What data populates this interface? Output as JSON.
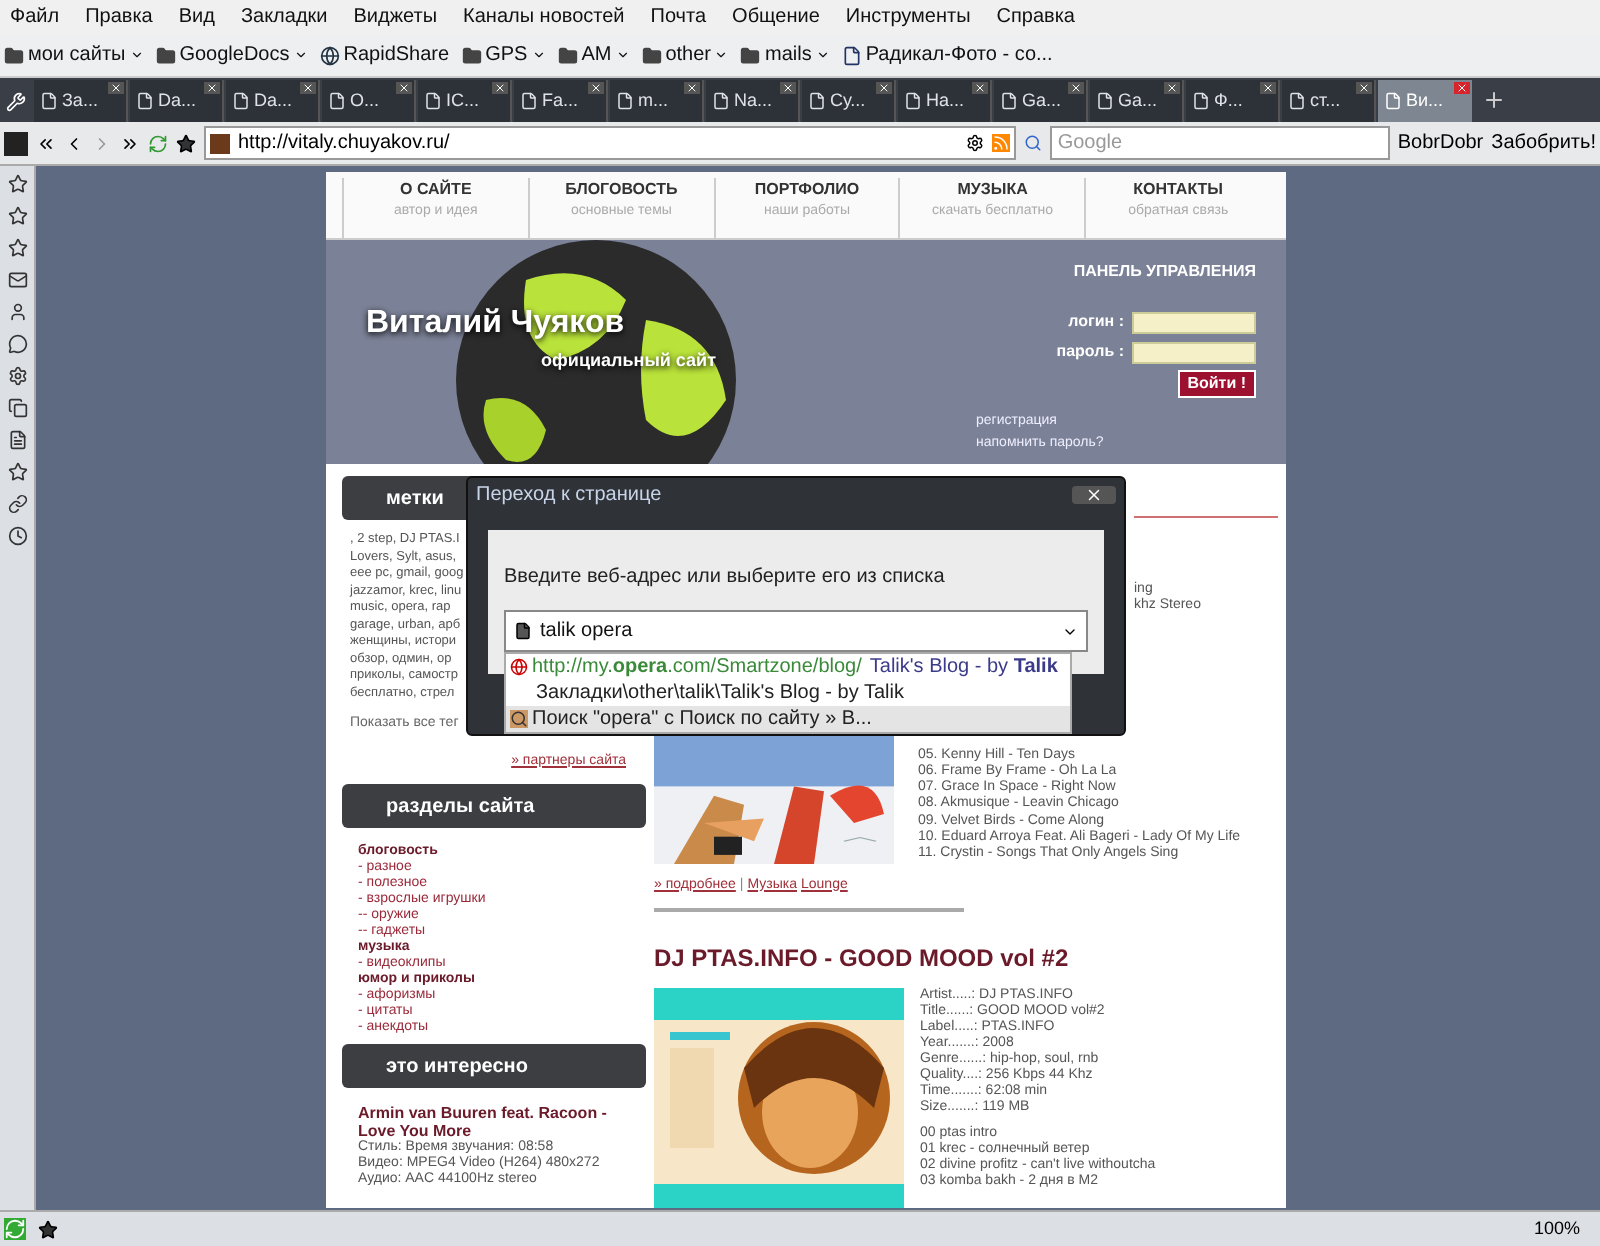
{
  "menu": [
    "Файл",
    "Правка",
    "Вид",
    "Закладки",
    "Виджеты",
    "Каналы новостей",
    "Почта",
    "Общение",
    "Инструменты",
    "Справка"
  ],
  "bookmarks": [
    {
      "label": "мои сайты",
      "kind": "folder",
      "has_menu": true
    },
    {
      "label": "GoogleDocs",
      "kind": "folder",
      "has_menu": true
    },
    {
      "label": "RapidShare",
      "kind": "site",
      "has_menu": false
    },
    {
      "label": "GPS",
      "kind": "folder",
      "has_menu": true
    },
    {
      "label": "AM",
      "kind": "folder",
      "has_menu": true
    },
    {
      "label": "other",
      "kind": "folder",
      "has_menu": true
    },
    {
      "label": "mails",
      "kind": "folder",
      "has_menu": true
    },
    {
      "label": "Радикал-Фото - со...",
      "has_menu": false
    }
  ],
  "tabs": [
    {
      "title": "За...",
      "selected": false
    },
    {
      "title": "Da...",
      "selected": false
    },
    {
      "title": "Da...",
      "selected": false
    },
    {
      "title": "O...",
      "selected": false
    },
    {
      "title": "IC...",
      "selected": false
    },
    {
      "title": "Fa...",
      "selected": false
    },
    {
      "title": "m...",
      "selected": false
    },
    {
      "title": "Na...",
      "selected": false
    },
    {
      "title": "Су...",
      "selected": false
    },
    {
      "title": "На...",
      "selected": false
    },
    {
      "title": "Ga...",
      "selected": false
    },
    {
      "title": "Ga...",
      "selected": false
    },
    {
      "title": "Ф...",
      "selected": false
    },
    {
      "title": "ст...",
      "selected": false
    },
    {
      "title": "Ви...",
      "selected": true
    }
  ],
  "address_bar": {
    "url": "http://vitaly.chuyakov.ru/",
    "search_placeholder": "Google",
    "extras": [
      "BobrDobr",
      "Забобрить!"
    ]
  },
  "site": {
    "nav": [
      {
        "title": "О САЙТЕ",
        "subtitle": "автор и идея"
      },
      {
        "title": "БЛОГОВОСТЬ",
        "subtitle": "основные темы"
      },
      {
        "title": "ПОРТФОЛИО",
        "subtitle": "наши работы"
      },
      {
        "title": "МУЗЫКА",
        "subtitle": "скачать бесплатно"
      },
      {
        "title": "КОНТАКТЫ",
        "subtitle": "обратная связь"
      }
    ],
    "header": {
      "name": "Виталий Чуяков",
      "tagline": "официальный сайт"
    },
    "login": {
      "title": "ПАНЕЛЬ УПРАВЛЕНИЯ",
      "login_label": "логин :",
      "password_label": "пароль :",
      "button": "Войти !",
      "links": [
        "регистрация",
        "напомнить пароль?"
      ]
    },
    "sidebar": {
      "tags_title": "метки",
      "tag_lines": [
        ", 2 step, DJ PTAS.I",
        "Lovers, Sylt, asus,",
        "eee pc, gmail, goog",
        "jazzamor, krec, linu",
        "music, opera, rap",
        "garage, urban, арб",
        "женщины, истори",
        "обзор, одмин, ор",
        "приколы, самостр",
        "бесплатно, стрел"
      ],
      "show_all": "Показать все тег",
      "partners": "» партнеры сайта",
      "sections_title": "разделы сайта",
      "sections": [
        {
          "label": "блоговость",
          "kind": "group"
        },
        {
          "label": "- разное",
          "kind": "item"
        },
        {
          "label": "- полезное",
          "kind": "item"
        },
        {
          "label": "- взрослые игрушки",
          "kind": "item"
        },
        {
          "label": "-- оружие",
          "kind": "item"
        },
        {
          "label": "-- гаджеты",
          "kind": "item"
        },
        {
          "label": "музыка",
          "kind": "group"
        },
        {
          "label": "- видеоклипы",
          "kind": "item"
        },
        {
          "label": "юмор и приколы",
          "kind": "group"
        },
        {
          "label": "- афоризмы",
          "kind": "item"
        },
        {
          "label": "- цитаты",
          "kind": "item"
        },
        {
          "label": "- анекдоты",
          "kind": "item"
        }
      ],
      "interesting_title": "это интересно",
      "interesting": {
        "title": "Armin van Buuren feat. Racoon - Love You More",
        "lines": [
          "Стиль: Время звучания: 08:58",
          "Видео: MPEG4 Video (H264) 480x272",
          "Аудио: AAC 44100Hz stereo"
        ]
      }
    },
    "posts": [
      {
        "info": [
          "ing",
          "khz Stereo"
        ],
        "tracks": [
          "05. Kenny Hill - Ten Days",
          "06. Frame By Frame - Oh La La",
          "07. Grace In Space - Right Now",
          "08. Akmusique - Leavin Chicago",
          "09. Velvet Birds - Come Along",
          "10. Eduard Arroya Feat. Ali Bageri - Lady Of My Life",
          "11. Crystin - Songs That Only Angels Sing"
        ],
        "more": "» подробнее",
        "separator": "|",
        "tags": [
          "Музыка",
          "Lounge"
        ]
      },
      {
        "title": "DJ PTAS.INFO - GOOD MOOD vol #2",
        "info": [
          "Artist.....: DJ PTAS.INFO",
          "Title......: GOOD MOOD vol#2",
          "Label.....: PTAS.INFO",
          "Year.......: 2008",
          "Genre......: hip-hop, soul, rnb",
          "Quality....: 256 Kbps 44 Khz",
          "Time.......: 62:08 min",
          "Size.......: 119 MB"
        ],
        "tracks": [
          "00 ptas intro",
          "01 krec - солнечный ветер",
          "02 divine profitz - can't live withoutcha",
          "03 komba bakh - 2 дня в М2"
        ]
      }
    ]
  },
  "dialog": {
    "title": "Переход к странице",
    "prompt": "Введите веб-адрес или выберите его из списка",
    "value": "talik opera",
    "suggestions": [
      {
        "kind": "history",
        "address": "http://my.**opera**.com/Smartzone/blog/",
        "title": "Talik's Blog - by **Talik**",
        "selected": false
      },
      {
        "kind": "bookmark",
        "address": "Закладки\\other\\talik\\Talik's Blog - by Talik",
        "selected": false
      },
      {
        "kind": "search",
        "address": "Поиск \"opera\" с Поиск по сайту » В...",
        "selected": true
      }
    ]
  },
  "status_bar": {
    "zoom": "100%"
  }
}
